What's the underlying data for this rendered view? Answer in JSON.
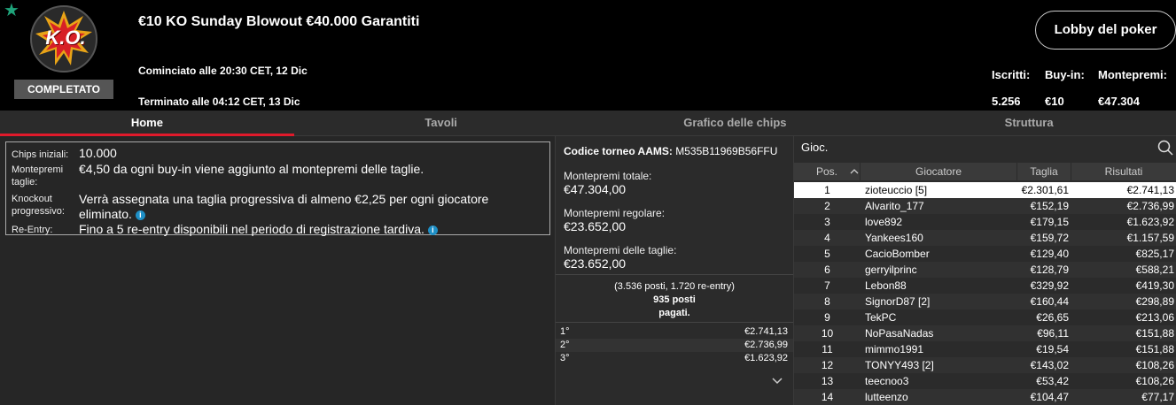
{
  "header": {
    "logo_text": "K.O.",
    "status_badge": "COMPLETATO",
    "title": "€10 KO Sunday Blowout €40.000 Garantiti",
    "started": "Cominciato alle 20:30 CET, 12 Dic",
    "ended": "Terminato alle 04:12 CET, 13 Dic",
    "lobby_button": "Lobby del poker",
    "stats": {
      "registered_label": "Iscritti:",
      "registered_value": "5.256",
      "buyin_label": "Buy-in:",
      "buyin_value": "€10",
      "prizepool_label": "Montepremi:",
      "prizepool_value": "€47.304"
    }
  },
  "tabs": [
    {
      "label": "Home",
      "active": true
    },
    {
      "label": "Tavoli",
      "active": false
    },
    {
      "label": "Grafico delle chips",
      "active": false
    },
    {
      "label": "Struttura",
      "active": false
    }
  ],
  "info": {
    "chips_label": "Chips iniziali:",
    "chips_value": "10.000",
    "bounty_label": "Montepremi taglie:",
    "bounty_value": "€4,50 da ogni buy-in viene aggiunto al montepremi delle taglie.",
    "knockout_label": "Knockout progressivo:",
    "knockout_value": "Verrà assegnata una taglia progressiva di almeno €2,25 per ogni giocatore eliminato.",
    "reentry_label": "Re-Entry:",
    "reentry_value": "Fino a 5 re-entry disponibili nel periodo di registrazione tardiva."
  },
  "prizes": {
    "aams_label": "Codice torneo AAMS:",
    "aams_code": "M535B11969B56FFU",
    "total_label": "Montepremi totale:",
    "total_value": "€47.304,00",
    "regular_label": "Montepremi regolare:",
    "regular_value": "€23.652,00",
    "bounty_label": "Montepremi delle taglie:",
    "bounty_value": "€23.652,00",
    "seats_line1": "(3.536 posti, 1.720 re-entry)",
    "seats_line2": "935 posti",
    "seats_line3": "pagati.",
    "places": [
      {
        "pos": "1°",
        "value": "€2.741,13"
      },
      {
        "pos": "2°",
        "value": "€2.736,99"
      },
      {
        "pos": "3°",
        "value": "€1.623,92"
      }
    ]
  },
  "players": {
    "search_label": "Gioc.",
    "columns": {
      "pos": "Pos.",
      "player": "Giocatore",
      "bounty": "Taglia",
      "results": "Risultati"
    },
    "rows": [
      {
        "pos": "1",
        "name": "zioteuccio [5]",
        "bounty": "€2.301,61",
        "result": "€2.741,13"
      },
      {
        "pos": "2",
        "name": "Alvarito_177",
        "bounty": "€152,19",
        "result": "€2.736,99"
      },
      {
        "pos": "3",
        "name": "love892",
        "bounty": "€179,15",
        "result": "€1.623,92"
      },
      {
        "pos": "4",
        "name": "Yankees160",
        "bounty": "€159,72",
        "result": "€1.157,59"
      },
      {
        "pos": "5",
        "name": "CacioBomber",
        "bounty": "€129,40",
        "result": "€825,17"
      },
      {
        "pos": "6",
        "name": "gerryilprinc",
        "bounty": "€128,79",
        "result": "€588,21"
      },
      {
        "pos": "7",
        "name": "Lebon88",
        "bounty": "€329,92",
        "result": "€419,30"
      },
      {
        "pos": "8",
        "name": "SignorD87 [2]",
        "bounty": "€160,44",
        "result": "€298,89"
      },
      {
        "pos": "9",
        "name": "TekPC",
        "bounty": "€26,65",
        "result": "€213,06"
      },
      {
        "pos": "10",
        "name": "NoPasaNadas",
        "bounty": "€96,11",
        "result": "€151,88"
      },
      {
        "pos": "11",
        "name": "mimmo1991",
        "bounty": "€19,54",
        "result": "€151,88"
      },
      {
        "pos": "12",
        "name": "TONYY493 [2]",
        "bounty": "€143,02",
        "result": "€108,26"
      },
      {
        "pos": "13",
        "name": "teecnoo3",
        "bounty": "€53,42",
        "result": "€108,26"
      },
      {
        "pos": "14",
        "name": "lutteenzo",
        "bounty": "€104,47",
        "result": "€77,17"
      }
    ]
  },
  "colors": {
    "accent": "#e01a2b",
    "favorite": "#1fa37a",
    "info_icon": "#1e8fc6"
  }
}
